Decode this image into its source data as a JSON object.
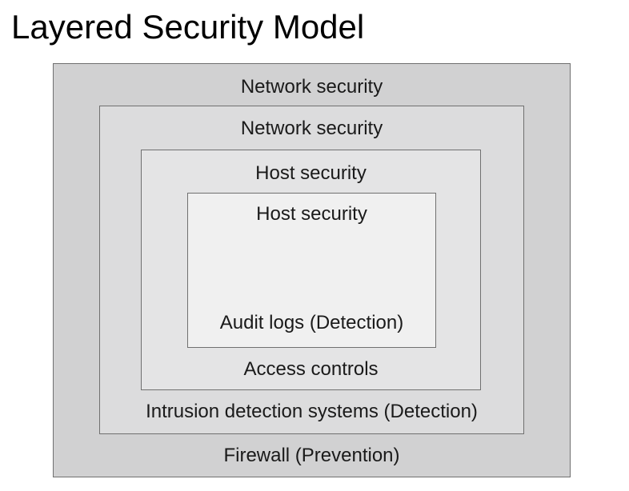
{
  "title": "Layered Security Model",
  "layers": [
    {
      "top_label": "Network security",
      "bottom_label": "Firewall (Prevention)"
    },
    {
      "top_label": "Network security",
      "bottom_label": "Intrusion detection systems (Detection)"
    },
    {
      "top_label": "Host security",
      "bottom_label": "Access controls"
    },
    {
      "top_label": "Host security",
      "bottom_label": "Audit logs (Detection)"
    }
  ],
  "colors": {
    "layer1_fill": "#d1d1d2",
    "layer2_fill": "#dcdcdd",
    "layer3_fill": "#e4e4e5",
    "layer4_fill": "#f0f0f0",
    "border": "#707070",
    "text": "#1a1a1a"
  }
}
